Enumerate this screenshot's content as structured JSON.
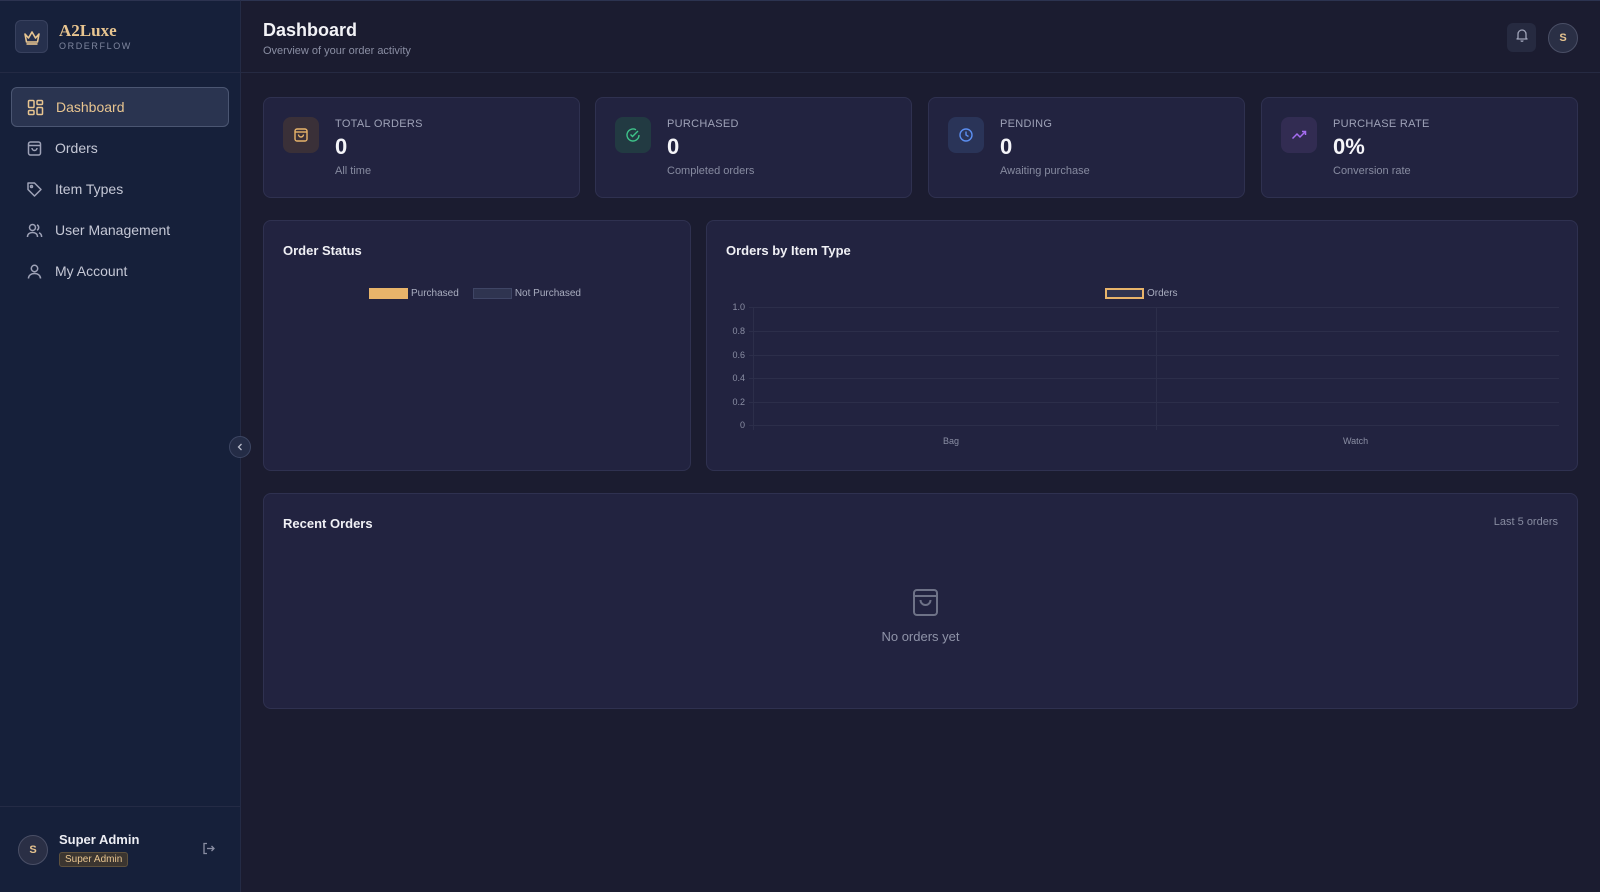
{
  "brand": {
    "name": "A2Luxe",
    "subtitle": "ORDERFLOW"
  },
  "nav": [
    {
      "label": "Dashboard",
      "icon": "dashboard-grid-icon",
      "active": true
    },
    {
      "label": "Orders",
      "icon": "shopping-bag-icon",
      "active": false
    },
    {
      "label": "Item Types",
      "icon": "tag-icon",
      "active": false
    },
    {
      "label": "User Management",
      "icon": "users-icon",
      "active": false
    },
    {
      "label": "My Account",
      "icon": "user-icon",
      "active": false
    }
  ],
  "user": {
    "name": "Super Admin",
    "role": "Super Admin",
    "initial": "S"
  },
  "header": {
    "title": "Dashboard",
    "subtitle": "Overview of your order activity",
    "avatar_initial": "S"
  },
  "stats": [
    {
      "label": "TOTAL ORDERS",
      "value": "0",
      "desc": "All time",
      "icon": "shopping-bag-icon",
      "color": "#e8b46a"
    },
    {
      "label": "PURCHASED",
      "value": "0",
      "desc": "Completed orders",
      "icon": "check-circle-icon",
      "color": "#3ec48a"
    },
    {
      "label": "PENDING",
      "value": "0",
      "desc": "Awaiting purchase",
      "icon": "clock-icon",
      "color": "#5b8ef0"
    },
    {
      "label": "PURCHASE RATE",
      "value": "0%",
      "desc": "Conversion rate",
      "icon": "trending-up-icon",
      "color": "#a56df0"
    }
  ],
  "order_status": {
    "title": "Order Status",
    "legend": [
      {
        "label": "Purchased",
        "color": "#e8b46a"
      },
      {
        "label": "Not Purchased",
        "color": "#2f3450"
      }
    ]
  },
  "orders_by_type": {
    "title": "Orders by Item Type",
    "legend": [
      {
        "label": "Orders",
        "color": "#e8b46a"
      }
    ]
  },
  "recent_orders": {
    "title": "Recent Orders",
    "meta": "Last 5 orders",
    "empty": "No orders yet"
  },
  "chart_data": [
    {
      "type": "pie",
      "title": "Order Status",
      "categories": [
        "Purchased",
        "Not Purchased"
      ],
      "values": [
        0,
        0
      ]
    },
    {
      "type": "bar",
      "title": "Orders by Item Type",
      "categories": [
        "Bag",
        "Watch"
      ],
      "series": [
        {
          "name": "Orders",
          "values": [
            0,
            0
          ]
        }
      ],
      "y_ticks": [
        "0",
        "0.2",
        "0.4",
        "0.6",
        "0.8",
        "1.0"
      ],
      "ylim": [
        0,
        1
      ],
      "grid": true,
      "legend": "top-center"
    }
  ]
}
